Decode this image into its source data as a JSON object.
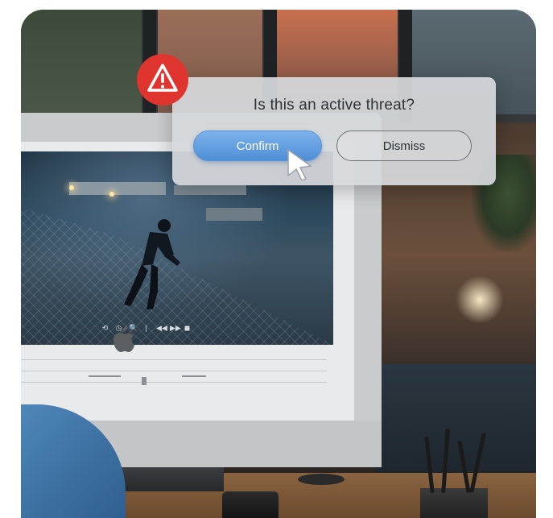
{
  "dialog": {
    "question": "Is this an active threat?",
    "confirm_label": "Confirm",
    "dismiss_label": "Dismiss"
  },
  "icons": {
    "alert": "warning-triangle-icon",
    "cursor": "pointer-cursor-icon",
    "brand": "apple-logo-icon"
  },
  "colors": {
    "alert_red": "#e0352f",
    "confirm_blue": "#5a97dc"
  },
  "video_controls": [
    "⟲",
    "◷",
    "🔍",
    "|",
    "◀◀",
    "▶▶",
    "◼"
  ]
}
